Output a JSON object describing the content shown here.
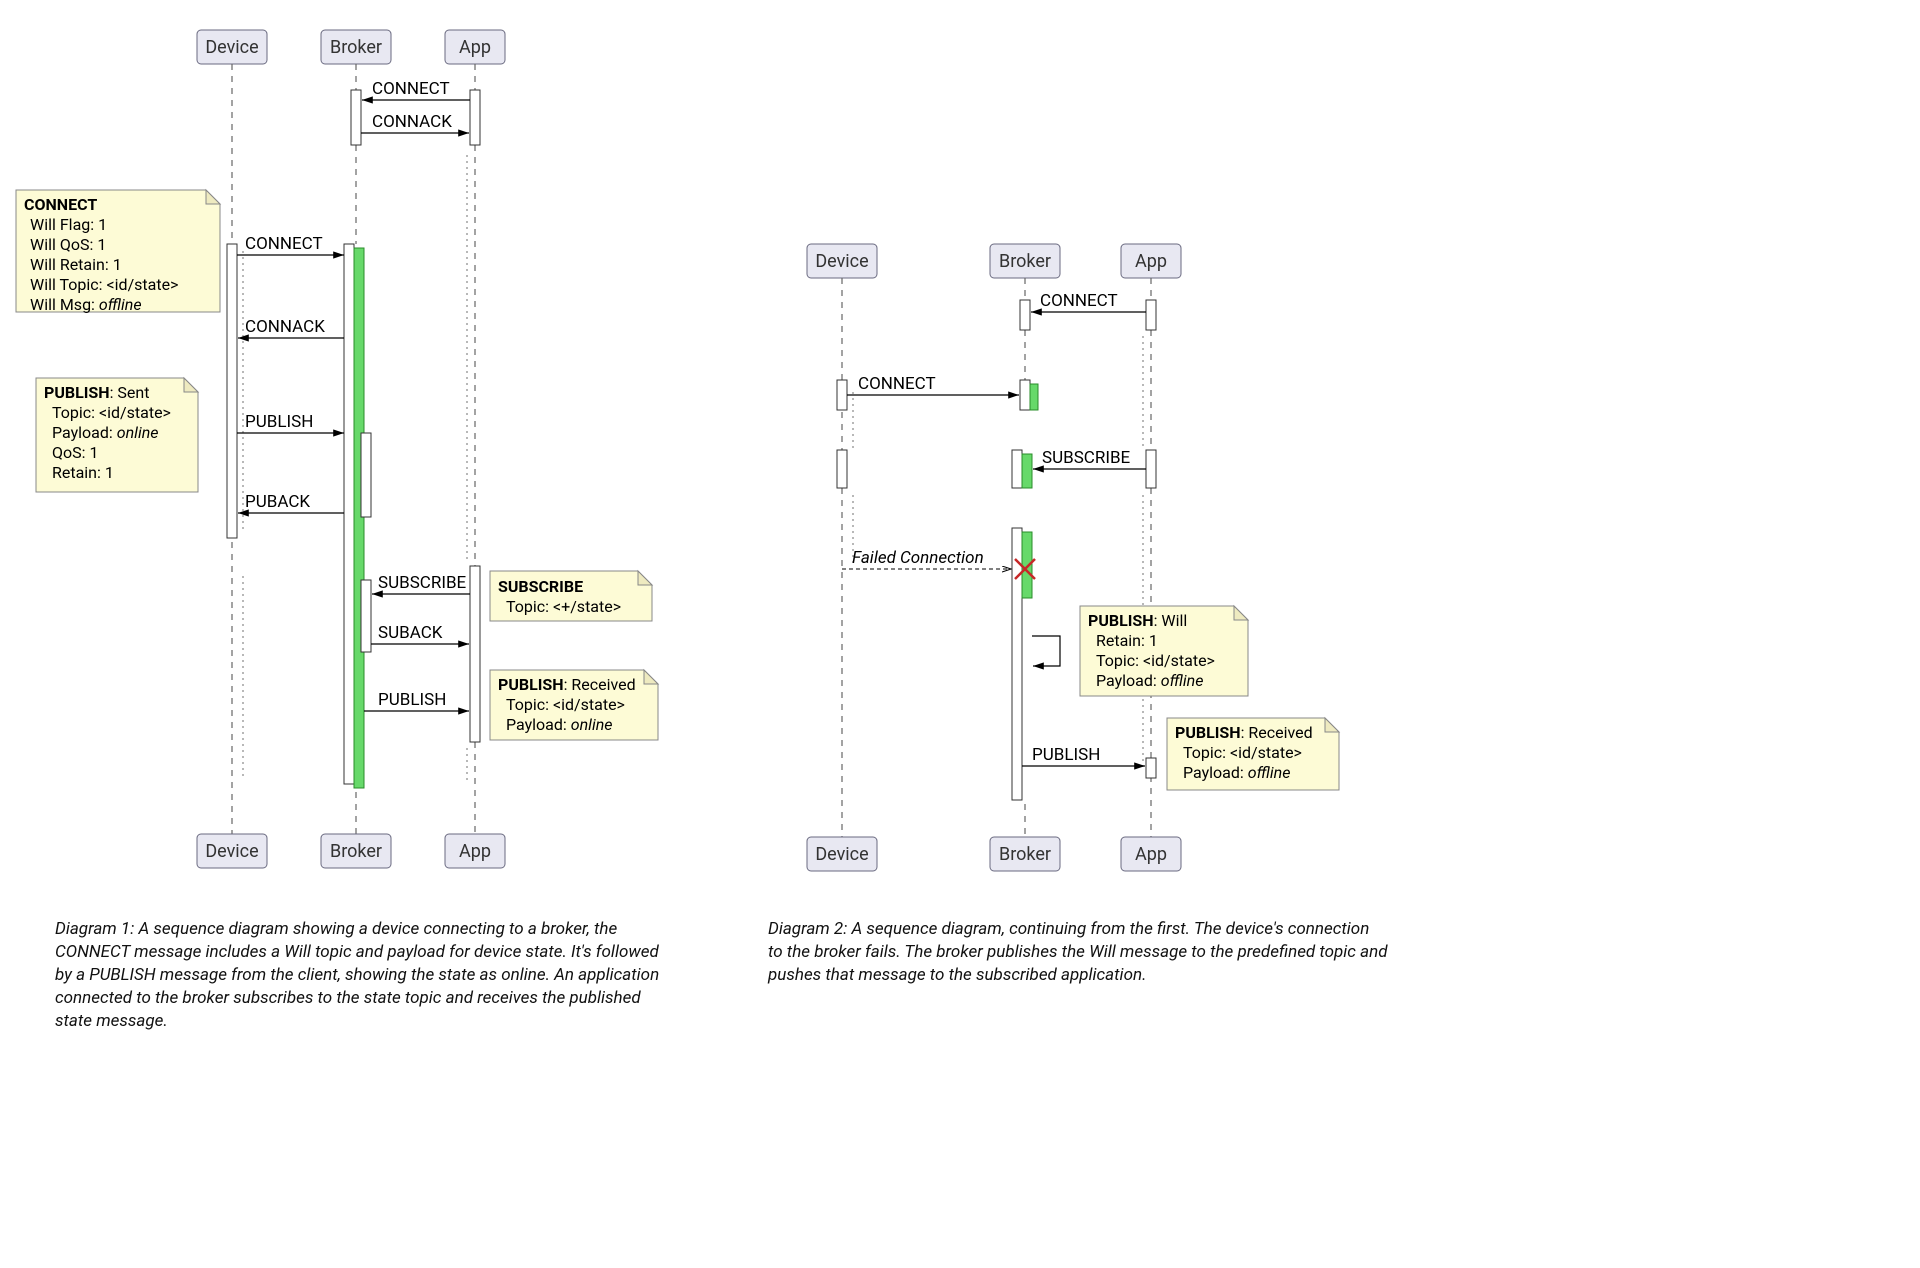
{
  "actors": {
    "device": "Device",
    "broker": "Broker",
    "app": "App"
  },
  "messages": {
    "connect": "CONNECT",
    "connack": "CONNACK",
    "publish": "PUBLISH",
    "puback": "PUBACK",
    "subscribe": "SUBSCRIBE",
    "suback": "SUBACK",
    "failed": "Failed Connection"
  },
  "notes": {
    "connect": {
      "title": "CONNECT",
      "lines": [
        "Will Flag: 1",
        "Will QoS: 1",
        "Will Retain: 1",
        "Will Topic: <id/state>"
      ],
      "will_msg_label": "Will Msg:",
      "will_msg_value": "offline"
    },
    "publish_sent": {
      "title": "PUBLISH",
      "suffix": ": Sent",
      "topic": "Topic: <id/state>",
      "payload_label": "Payload:",
      "payload_value": "online",
      "qos": "QoS: 1",
      "retain": "Retain: 1"
    },
    "subscribe": {
      "title": "SUBSCRIBE",
      "topic": "Topic: <+/state>"
    },
    "publish_received": {
      "title": "PUBLISH",
      "suffix": ": Received",
      "topic": "Topic: <id/state>",
      "payload_label": "Payload:",
      "payload_value": "online"
    },
    "publish_will": {
      "title": "PUBLISH",
      "suffix": ": Will",
      "retain": "Retain: 1",
      "topic": "Topic: <id/state>",
      "payload_label": "Payload:",
      "payload_value": "offline"
    },
    "publish_received2": {
      "title": "PUBLISH",
      "suffix": ": Received",
      "topic": "Topic: <id/state>",
      "payload_label": "Payload:",
      "payload_value": "offline"
    }
  },
  "captions": {
    "d1": "Diagram 1: A sequence diagram showing a device connecting to a broker, the CONNECT message includes a Will topic and payload for device state. It's followed by a PUBLISH message from the client, showing the state as online. An application connected to the broker subscribes to the state topic and receives the published state message.",
    "d2": "Diagram 2: A sequence diagram, continuing from the first. The device's connection to the broker fails. The broker publishes the Will message to the predefined topic and pushes that message to the subscribed application."
  }
}
